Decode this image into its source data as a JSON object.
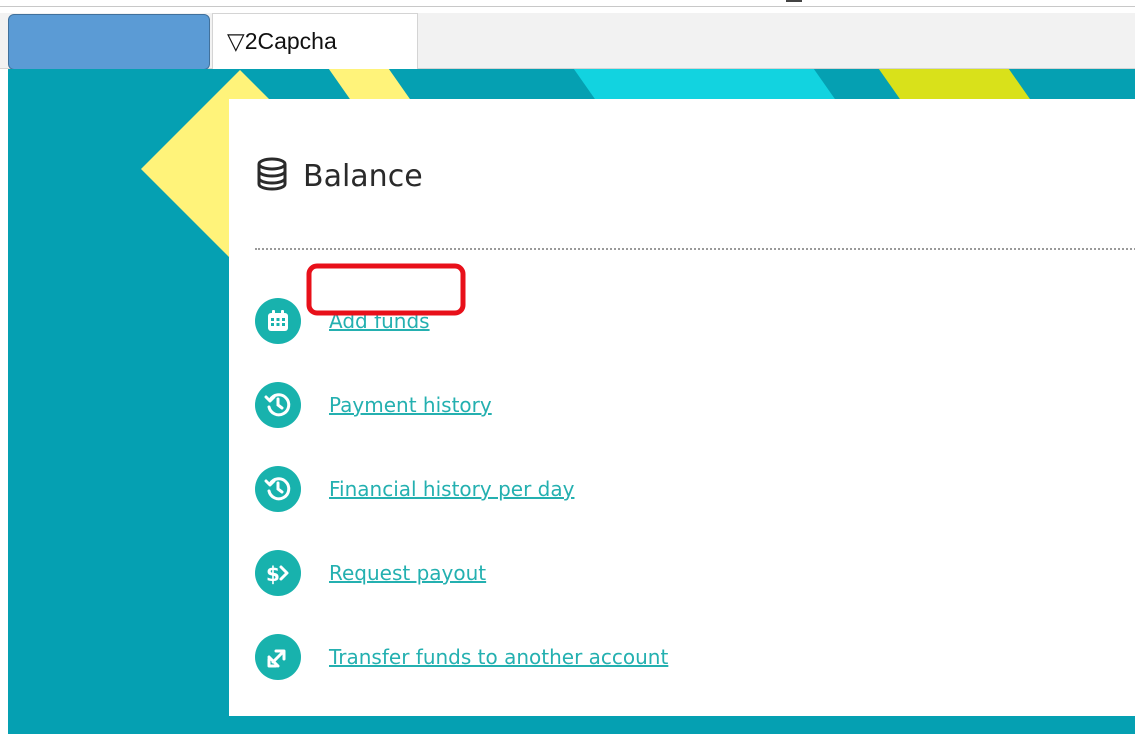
{
  "tabs": [
    {
      "label": "",
      "color": "#5b9bd5"
    },
    {
      "label": "▽2Capcha",
      "active": true
    }
  ],
  "card": {
    "title": "Balance",
    "icon": "database-icon"
  },
  "links": [
    {
      "label": "Add funds",
      "icon": "calendar-icon",
      "highlighted": true
    },
    {
      "label": "Payment history",
      "icon": "history-icon"
    },
    {
      "label": "Financial history per day",
      "icon": "history-icon"
    },
    {
      "label": "Request payout",
      "icon": "dollar-arrow-icon"
    },
    {
      "label": "Transfer funds to another account",
      "icon": "transfer-arrows-icon"
    }
  ],
  "colors": {
    "page_background": "#05a0b2",
    "accent_cyan": "#12d3e0",
    "accent_yellow": "#fff37a",
    "accent_lime": "#d9e11a",
    "link_color": "#24b0b0",
    "icon_circle": "#18b2ad",
    "highlight_border": "#e8101a"
  }
}
